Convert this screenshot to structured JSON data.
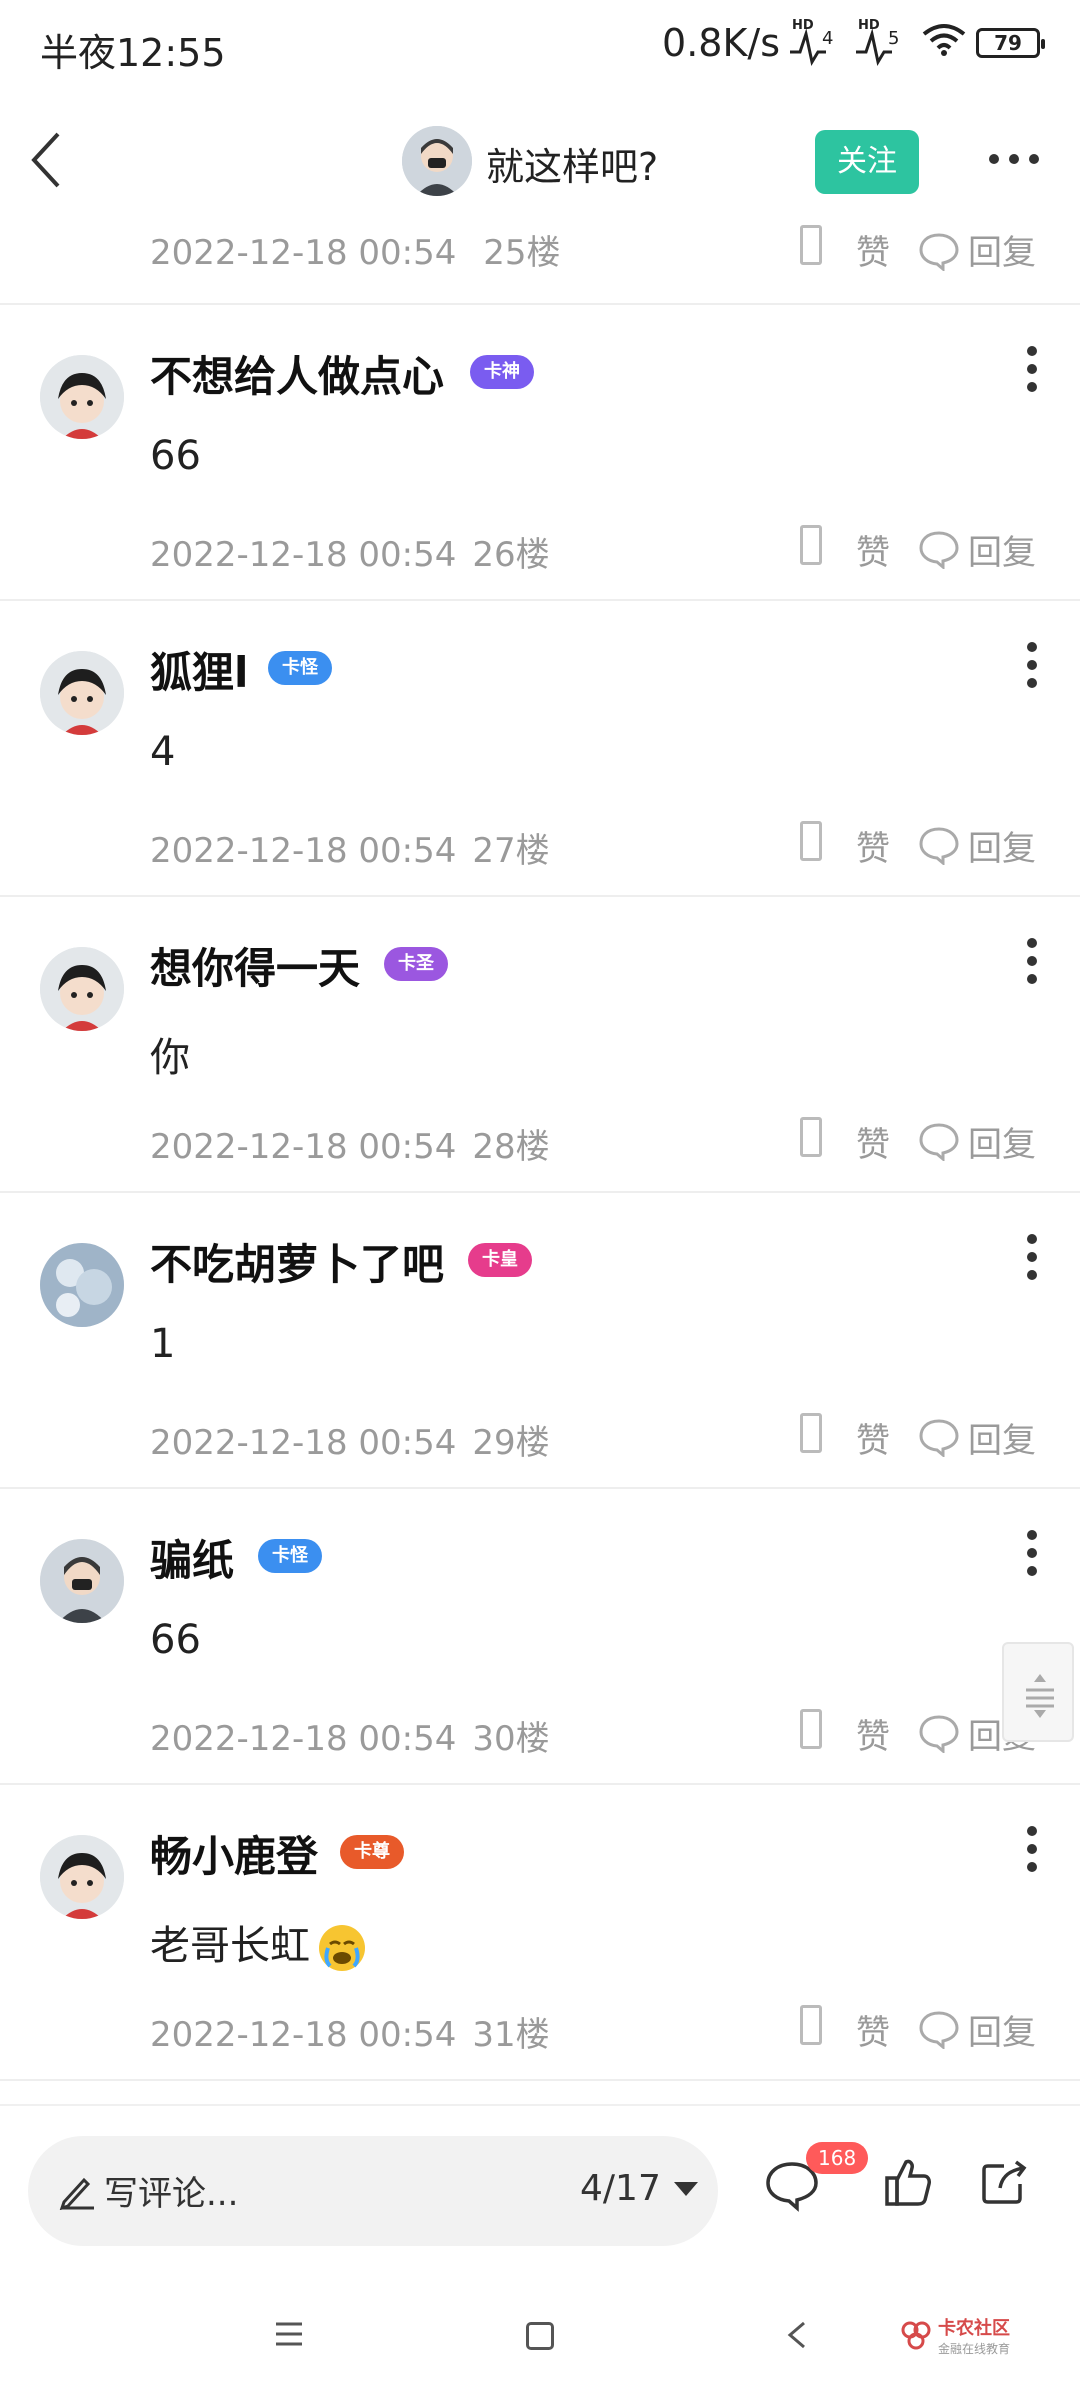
{
  "status_bar": {
    "time": "半夜12:55",
    "speed": "0.8K/s",
    "sim1_label": "HD",
    "sim1_num": "4",
    "sim2_label": "HD",
    "sim2_num": "5",
    "battery": "79"
  },
  "header": {
    "title": "就这样吧?",
    "follow_label": "关注"
  },
  "top_meta": {
    "date": "2022-12-18 00:54",
    "floor": "25楼",
    "like_label": "赞",
    "reply_label": "回复"
  },
  "posts": [
    {
      "username": "不想给人做点心",
      "badge": "卡神",
      "badge_color": "#7a5cf0",
      "content": "66",
      "date": "2022-12-18 00:54",
      "floor": "26楼",
      "like_label": "赞",
      "reply_label": "回复"
    },
    {
      "username": "狐狸l",
      "badge": "卡怪",
      "badge_color": "#3b8ff0",
      "content": "4",
      "date": "2022-12-18 00:54",
      "floor": "27楼",
      "like_label": "赞",
      "reply_label": "回复"
    },
    {
      "username": "想你得一天",
      "badge": "卡圣",
      "badge_color": "#9b57e0",
      "content": "你",
      "date": "2022-12-18 00:54",
      "floor": "28楼",
      "like_label": "赞",
      "reply_label": "回复"
    },
    {
      "username": "不吃胡萝卜了吧",
      "badge": "卡皇",
      "badge_color": "#e63c8c",
      "content": "1",
      "date": "2022-12-18 00:54",
      "floor": "29楼",
      "like_label": "赞",
      "reply_label": "回复"
    },
    {
      "username": "骗纸",
      "badge": "卡怪",
      "badge_color": "#3b8ff0",
      "content": "66",
      "date": "2022-12-18 00:54",
      "floor": "30楼",
      "like_label": "赞",
      "reply_label": "回复"
    },
    {
      "username": "畅小鹿登",
      "badge": "卡尊",
      "badge_color": "#e85a2a",
      "content": "老哥长虹",
      "date": "2022-12-18 00:54",
      "floor": "31楼",
      "like_label": "赞",
      "reply_label": "回复"
    }
  ],
  "bottom_bar": {
    "comment_placeholder": "写评论...",
    "page_indicator": "4/17",
    "comment_count": "168"
  },
  "watermark": {
    "title": "卡农社区",
    "subtitle": "金融在线教育"
  },
  "colors": {
    "accent": "#2dc4a0",
    "badge_red": "#ff5a5a",
    "meta_gray": "#9a9a9a"
  }
}
